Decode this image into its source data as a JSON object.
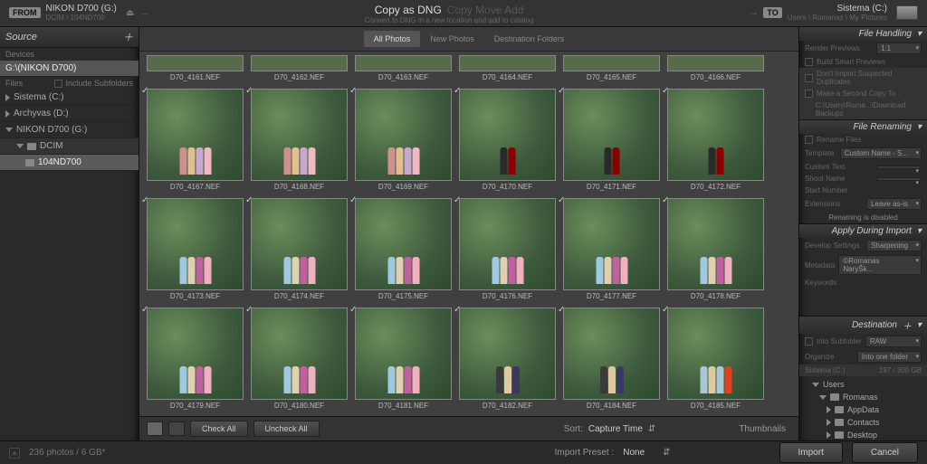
{
  "top": {
    "from_badge": "FROM",
    "from_device": "NIKON D700 (G:)",
    "from_path": "DCIM \\ 104ND700",
    "title": "Copy as DNG",
    "title_actions": "Copy   Move   Add",
    "subtitle": "Convert to DNG in a new location and add to catalog",
    "to_badge": "TO",
    "to_device": "Sistema (C:)",
    "to_path": "Users \\ Romanas \\ My Pictures"
  },
  "left": {
    "header": "Source",
    "devices_label": "Devices",
    "device_selected": "G:\\(NIKON D700)",
    "files_label": "Files",
    "include_sub": "Include Subfolders",
    "drives": [
      "Sistema (C:)",
      "Archyvas (D:)",
      "NIKON D700 (G:)"
    ],
    "folder1": "DCIM",
    "folder2": "104ND700"
  },
  "tabs": {
    "all": "All Photos",
    "new": "New Photos",
    "dest": "Destination Folders"
  },
  "thumbs": {
    "r0": [
      "D70_4161.NEF",
      "D70_4162.NEF",
      "D70_4163.NEF",
      "D70_4164.NEF",
      "D70_4165.NEF",
      "D70_4166.NEF"
    ],
    "r1": [
      "D70_4167.NEF",
      "D70_4168.NEF",
      "D70_4169.NEF",
      "D70_4170.NEF",
      "D70_4171.NEF",
      "D70_4172.NEF"
    ],
    "r2": [
      "D70_4173.NEF",
      "D70_4174.NEF",
      "D70_4175.NEF",
      "D70_4176.NEF",
      "D70_4177.NEF",
      "D70_4178.NEF"
    ],
    "r3": [
      "D70_4179.NEF",
      "D70_4180.NEF",
      "D70_4181.NEF",
      "D70_4182.NEF",
      "D70_4184.NEF",
      "D70_4185.NEF"
    ]
  },
  "toolbar": {
    "check_all": "Check All",
    "uncheck_all": "Uncheck All",
    "sort_label": "Sort:",
    "sort_value": "Capture Time",
    "thumbnails": "Thumbnails"
  },
  "right": {
    "file_handling": "File Handling",
    "render_previews": "Render Previews",
    "render_previews_v": "1:1",
    "build_smart": "Build Smart Previews",
    "no_dupes": "Don't Import Suspected Duplicates",
    "second_copy": "Make a Second Copy To :",
    "second_copy_path": "C:\\Users\\Roma...\\Download Backups",
    "file_renaming": "File Renaming",
    "rename_files": "Rename Files",
    "template": "Template",
    "template_v": "Custom Name - S...",
    "custom_text": "Custom Text",
    "shoot_name": "Shoot Name",
    "start_num": "Start Number",
    "extensions": "Extensions",
    "extensions_v": "Leave as-is",
    "renaming_disabled": "Renaming is disabled",
    "apply_during": "Apply During Import",
    "dev_settings": "Develop Settings",
    "dev_settings_v": "Sharpening",
    "metadata": "Metadata",
    "metadata_v": "©Romanas NaryŠk...",
    "keywords": "Keywords",
    "destination": "Destination",
    "into_sub": "Into Subfolder",
    "into_sub_v": "RAW",
    "organize": "Organize",
    "organize_v": "Into one folder",
    "sistema_c": "Sistema (C:)",
    "sistema_c_sz": "197 / 300 GB",
    "users": "Users",
    "romanas": "Romanas",
    "appdata": "AppData",
    "contacts": "Contacts",
    "desktop": "Desktop"
  },
  "bottom": {
    "status": "236 photos / 6 GB*",
    "import_preset": "Import Preset :",
    "preset_v": "None",
    "import": "Import",
    "cancel": "Cancel"
  }
}
